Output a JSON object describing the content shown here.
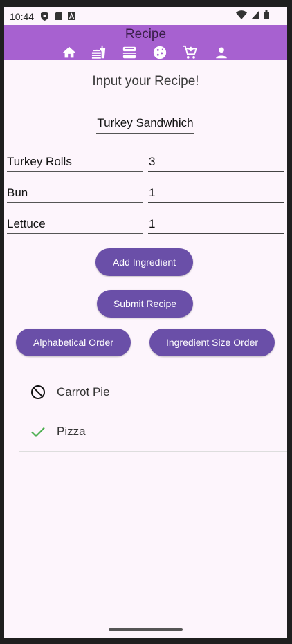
{
  "status_bar": {
    "time": "10:44",
    "left_icons": [
      "shield-icon",
      "sd-card-icon",
      "font-a-icon"
    ],
    "right_icons": [
      "wifi-icon",
      "cell-signal-icon",
      "battery-icon"
    ]
  },
  "appbar": {
    "title": "Recipe",
    "color": "#a761d0",
    "nav_icons": [
      "home-icon",
      "fastfood-icon",
      "dinner-icon",
      "cookie-icon",
      "cart-icon",
      "person-icon"
    ]
  },
  "form": {
    "heading": "Input your Recipe!",
    "recipe_name": "Turkey Sandwhich",
    "ingredients": [
      {
        "name": "Turkey Rolls",
        "qty": "3"
      },
      {
        "name": "Bun",
        "qty": "1"
      },
      {
        "name": "Lettuce",
        "qty": "1"
      }
    ]
  },
  "buttons": {
    "add_ingredient": "Add Ingredient",
    "submit_recipe": "Submit Recipe",
    "alphabetical_order": "Alphabetical Order",
    "ingredient_size_order": "Ingredient Size Order",
    "color": "#6a4fa8"
  },
  "recipes": [
    {
      "name": "Carrot Pie",
      "icon": "block-icon"
    },
    {
      "name": "Pizza",
      "icon": "check-icon"
    }
  ]
}
